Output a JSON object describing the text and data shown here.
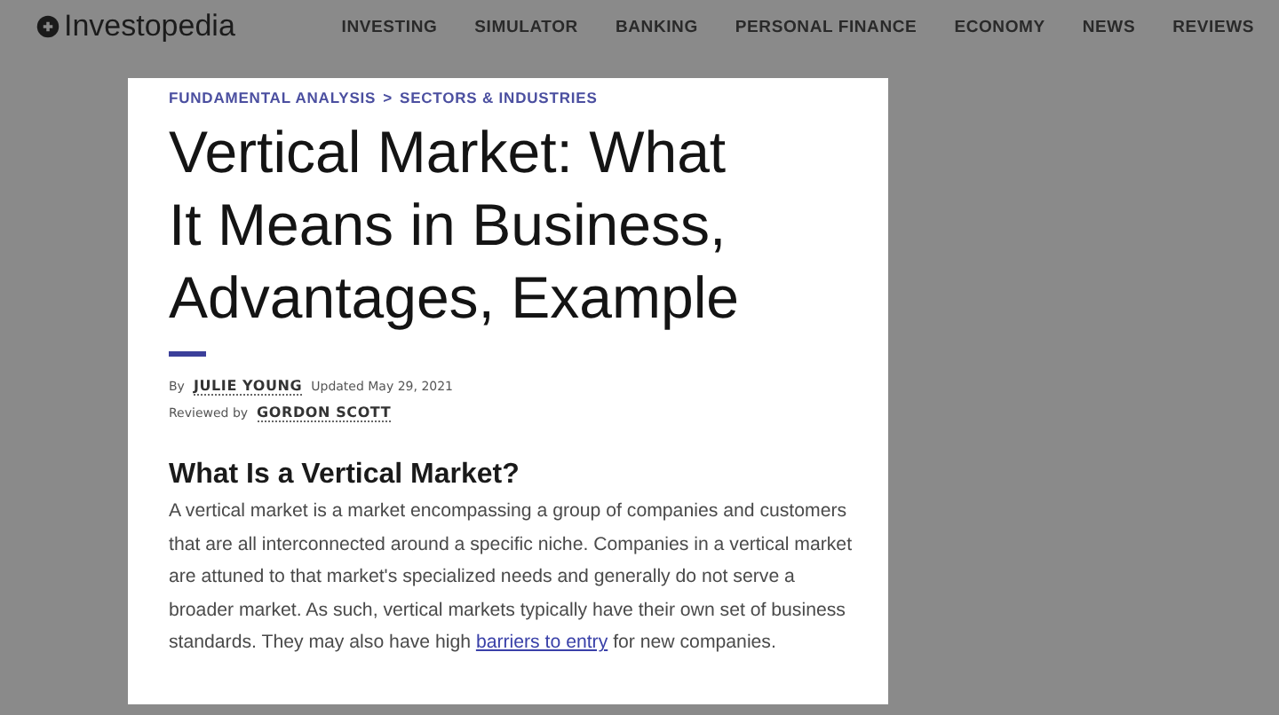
{
  "header": {
    "logo": "Investopedia",
    "nav": [
      "INVESTING",
      "SIMULATOR",
      "BANKING",
      "PERSONAL FINANCE",
      "ECONOMY",
      "NEWS",
      "REVIEWS"
    ]
  },
  "article": {
    "breadcrumbs": [
      "FUNDAMENTAL ANALYSIS",
      "SECTORS & INDUSTRIES"
    ],
    "separator": ">",
    "title": "Vertical Market: What It Means in Business, Advantages, Example",
    "byline": {
      "by_label": "By",
      "author": "JULIE YOUNG",
      "updated": "Updated May 29, 2021",
      "reviewed_label": "Reviewed by",
      "reviewer": "GORDON SCOTT"
    },
    "heading": "What Is a Vertical Market?",
    "paragraph": {
      "before": "A vertical market is a market encompassing a group of companies and customers that are all interconnected around a specific niche. Companies in a vertical market are attuned to that market's specialized needs and generally do not serve a broader market. As such, vertical markets typically have their own set of business standards. They may also have high ",
      "link": "barriers to entry",
      "after": " for new companies."
    }
  }
}
